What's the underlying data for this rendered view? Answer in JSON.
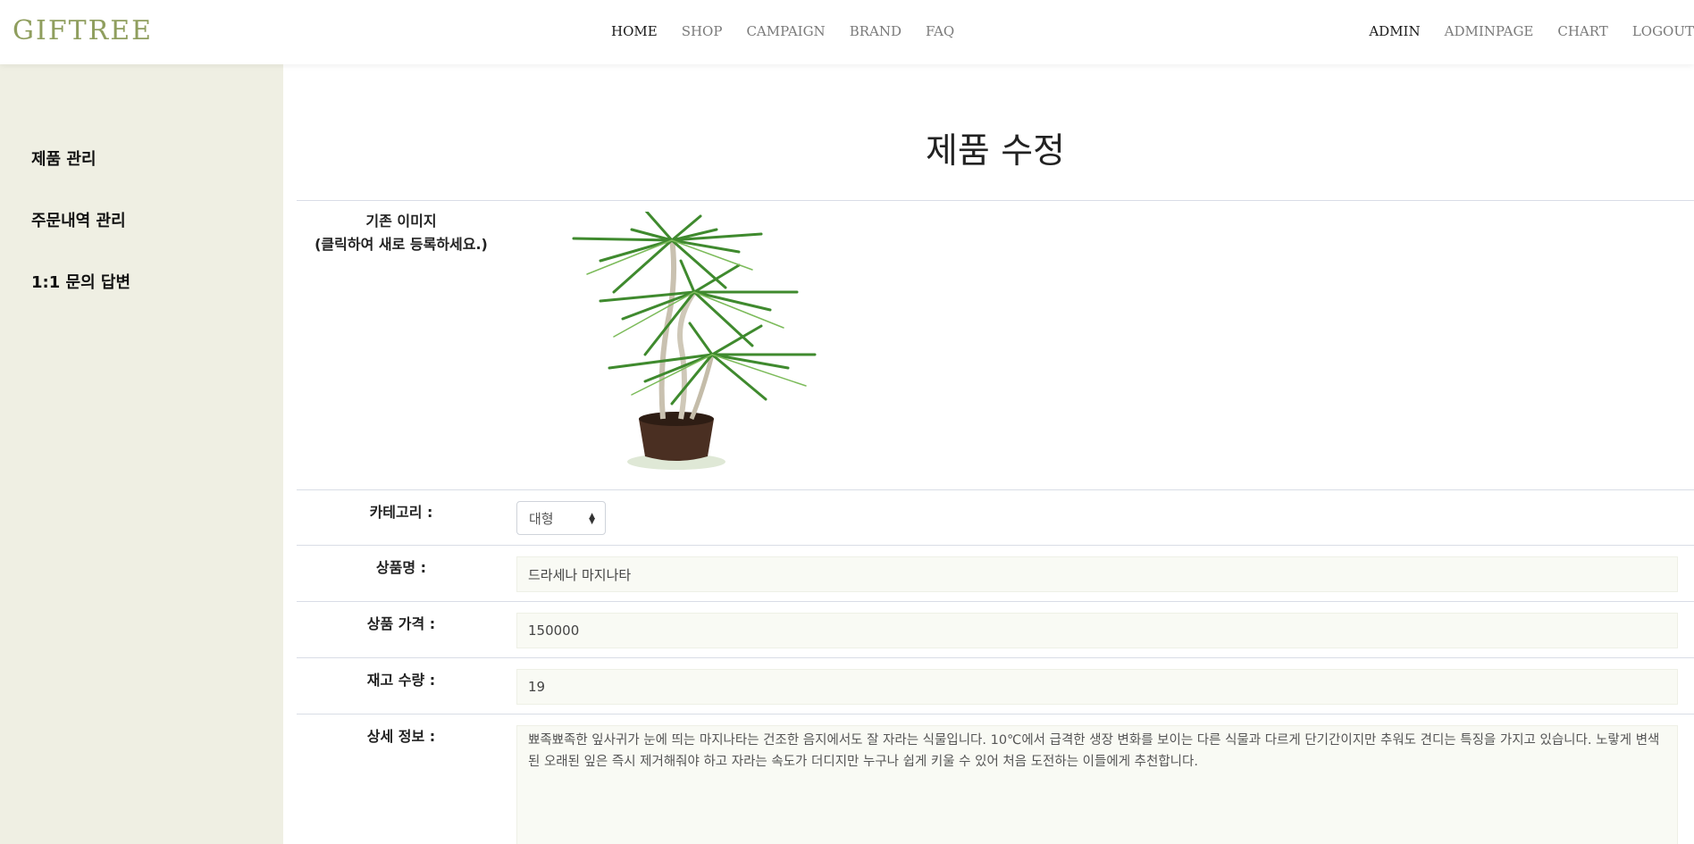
{
  "brand": {
    "logo": "GIFTREE"
  },
  "nav": {
    "main": [
      "HOME",
      "SHOP",
      "CAMPAIGN",
      "BRAND",
      "FAQ"
    ],
    "right": [
      "ADMIN",
      "ADMINPAGE",
      "CHART",
      "LOGOUT"
    ]
  },
  "sidebar": {
    "items": [
      "제품 관리",
      "주문내역 관리",
      "1:1 문의 답변"
    ]
  },
  "page": {
    "title": "제품 수정"
  },
  "form": {
    "image_label_1": "기존 이미지",
    "image_label_2": "(클릭하여 새로 등록하세요.)",
    "category_label": "카테고리 :",
    "category_value": "대형",
    "name_label": "상품명 :",
    "name_value": "드라세나 마지나타",
    "price_label": "상품 가격 :",
    "price_value": "150000",
    "stock_label": "재고 수량 :",
    "stock_value": "19",
    "detail_label": "상세 정보 :",
    "detail_value": "뾰족뾰족한 잎사귀가 눈에 띄는 마지나타는 건조한 음지에서도 잘 자라는 식물입니다. 10℃에서 급격한 생장 변화를 보이는 다른 식물과 다르게 단기간이지만 추워도 견디는 특징을 가지고 있습니다. 노랗게 변색된 오래된 잎은 즉시 제거해줘야 하고 자라는 속도가 더디지만 누구나 쉽게 키울 수 있어 처음 도전하는 이들에게 추천합니다."
  },
  "colors": {
    "logo": "#8f9e5e",
    "sidebar_bg": "#efefe3",
    "field_bg": "#f9faf4"
  }
}
